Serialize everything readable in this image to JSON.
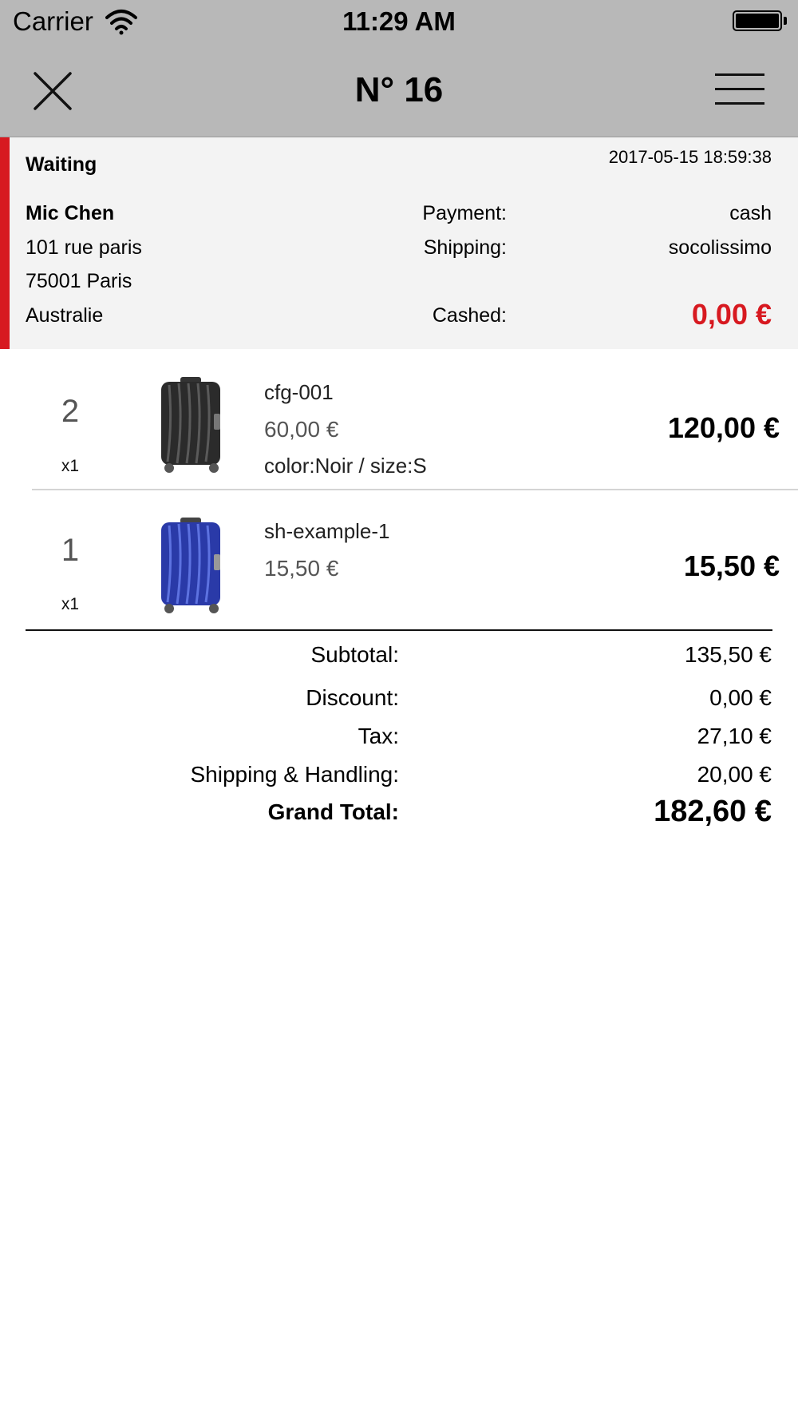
{
  "status_bar": {
    "carrier": "Carrier",
    "time": "11:29 AM"
  },
  "nav": {
    "title": "N° 16",
    "close_icon": "close-icon",
    "menu_icon": "hamburger-menu-icon"
  },
  "order": {
    "status": "Waiting",
    "date": "2017-05-15 18:59:38",
    "customer": {
      "name": "Mic Chen",
      "address_line1": "101 rue paris",
      "address_line2": "75001 Paris",
      "country": "Australie"
    },
    "payment_label": "Payment:",
    "payment_value": "cash",
    "shipping_label": "Shipping:",
    "shipping_value": "socolissimo",
    "cashed_label": "Cashed:",
    "cashed_value": "0,00 €",
    "status_color": "#d71920"
  },
  "items": [
    {
      "index": "2",
      "qty": "x1",
      "sku": "cfg-001",
      "unit_price": "60,00 €",
      "options": "color:Noir / size:S",
      "total": "120,00 €",
      "image": "luggage-black"
    },
    {
      "index": "1",
      "qty": "x1",
      "sku": "sh-example-1",
      "unit_price": "15,50 €",
      "options": "",
      "total": "15,50 €",
      "image": "luggage-blue"
    }
  ],
  "totals": {
    "subtotal_label": "Subtotal:",
    "subtotal": "135,50 €",
    "discount_label": "Discount:",
    "discount": "0,00 €",
    "tax_label": "Tax:",
    "tax": "27,10 €",
    "shipping_label": "Shipping & Handling:",
    "shipping": "20,00 €",
    "grand_label": "Grand Total:",
    "grand": "182,60 €"
  }
}
